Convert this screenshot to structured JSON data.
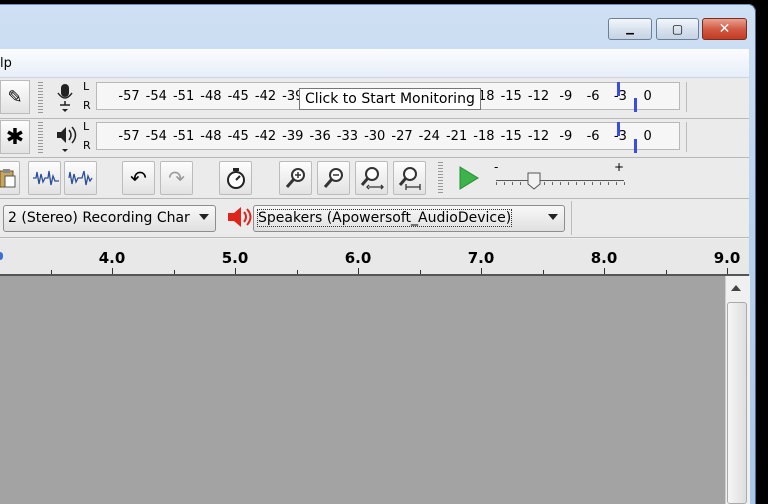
{
  "menu": {
    "help_partial": "lp"
  },
  "window": {
    "close_glyph": "✕",
    "minimize_glyph": "▁",
    "maximize_glyph": "▢"
  },
  "meters": {
    "recording": {
      "l_label": "L",
      "r_label": "R"
    },
    "playback": {
      "l_label": "L",
      "r_label": "R"
    },
    "ticks": [
      "-57",
      "-54",
      "-51",
      "-48",
      "-45",
      "-42",
      "-39",
      "-36",
      "-33",
      "-30",
      "-27",
      "-24",
      "-21",
      "-18",
      "-15",
      "-12",
      "-9",
      "-6",
      "-3",
      "0"
    ],
    "tooltip": "Click to Start Monitoring"
  },
  "tools": {
    "edit_symbol": "✎",
    "multi_symbol": "✱",
    "undo_glyph": "↶",
    "redo_glyph": "↷",
    "slider": {
      "minus": "-",
      "plus": "+",
      "level": 0.3
    }
  },
  "devices": {
    "recording_channels": "2 (Stereo) Recording Char",
    "playback_device": "Speakers (Apowersoft_AudioDevice)"
  },
  "ruler": {
    "labels": [
      "4.0",
      "5.0",
      "6.0",
      "7.0",
      "8.0",
      "9.0"
    ]
  },
  "colors": {
    "play_green": "#3cb44b",
    "speaker_red": "#e0231b",
    "meter_blue": "#3a4de0",
    "track_bg": "#a3a3a3"
  }
}
